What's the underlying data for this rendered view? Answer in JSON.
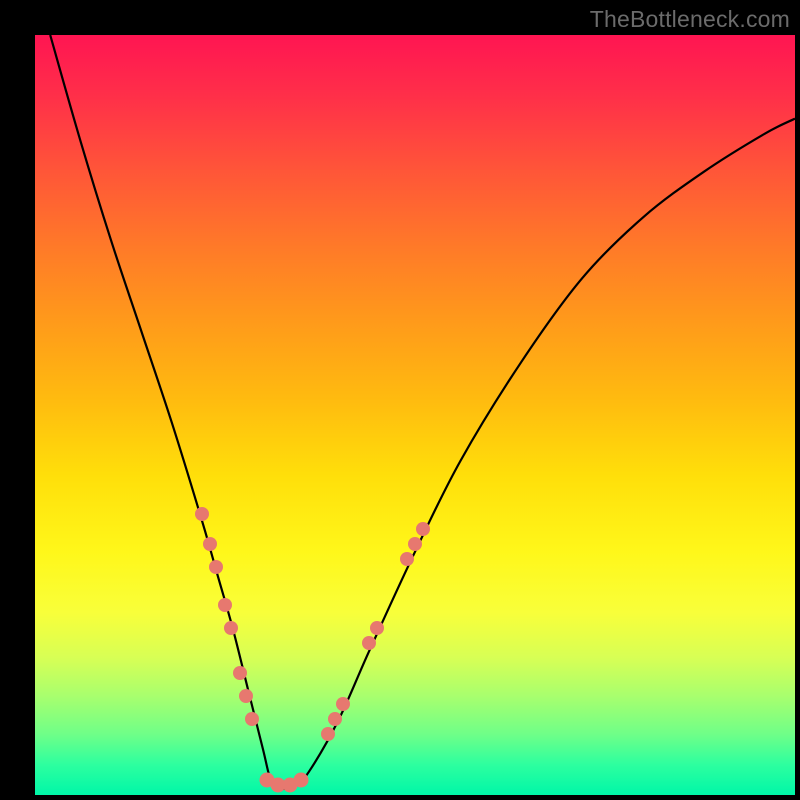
{
  "watermark": "TheBottleneck.com",
  "colors": {
    "dot": "#e7786f",
    "curve": "#000000",
    "page_bg": "#000000"
  },
  "chart_data": {
    "type": "line",
    "title": "",
    "xlabel": "",
    "ylabel": "",
    "xlim": [
      0,
      100
    ],
    "ylim": [
      0,
      100
    ],
    "series": [
      {
        "name": "bottleneck-curve",
        "x": [
          2,
          6,
          10,
          14,
          18,
          22,
          24,
          26,
          28,
          30,
          31,
          32,
          34,
          36,
          40,
          44,
          50,
          56,
          64,
          72,
          80,
          88,
          96,
          100
        ],
        "y": [
          100,
          86,
          73,
          61,
          49,
          36,
          29,
          22,
          14,
          6,
          2,
          1,
          1,
          3,
          10,
          19,
          32,
          44,
          57,
          68,
          76,
          82,
          87,
          89
        ]
      }
    ],
    "points": [
      {
        "name": "left-cluster-1",
        "x": 22.0,
        "y": 37,
        "size": 14
      },
      {
        "name": "left-cluster-2",
        "x": 23.0,
        "y": 33,
        "size": 14
      },
      {
        "name": "left-cluster-3",
        "x": 23.8,
        "y": 30,
        "size": 14
      },
      {
        "name": "left-cluster-4",
        "x": 25.0,
        "y": 25,
        "size": 14
      },
      {
        "name": "left-cluster-5",
        "x": 25.8,
        "y": 22,
        "size": 14
      },
      {
        "name": "left-cluster-6",
        "x": 27.0,
        "y": 16,
        "size": 14
      },
      {
        "name": "left-cluster-7",
        "x": 27.8,
        "y": 13,
        "size": 14
      },
      {
        "name": "left-cluster-8",
        "x": 28.5,
        "y": 10,
        "size": 14
      },
      {
        "name": "bottom-1",
        "x": 30.5,
        "y": 2.0,
        "size": 15
      },
      {
        "name": "bottom-2",
        "x": 32.0,
        "y": 1.3,
        "size": 15
      },
      {
        "name": "bottom-3",
        "x": 33.5,
        "y": 1.3,
        "size": 15
      },
      {
        "name": "bottom-4",
        "x": 35.0,
        "y": 2.0,
        "size": 15
      },
      {
        "name": "right-cluster-1",
        "x": 38.5,
        "y": 8,
        "size": 14
      },
      {
        "name": "right-cluster-2",
        "x": 39.5,
        "y": 10,
        "size": 14
      },
      {
        "name": "right-cluster-3",
        "x": 40.5,
        "y": 12,
        "size": 14
      },
      {
        "name": "right-cluster-4",
        "x": 44.0,
        "y": 20,
        "size": 14
      },
      {
        "name": "right-cluster-5",
        "x": 45.0,
        "y": 22,
        "size": 14
      },
      {
        "name": "right-cluster-6",
        "x": 49.0,
        "y": 31,
        "size": 14
      },
      {
        "name": "right-cluster-7",
        "x": 50.0,
        "y": 33,
        "size": 14
      },
      {
        "name": "right-cluster-8",
        "x": 51.0,
        "y": 35,
        "size": 14
      }
    ]
  }
}
